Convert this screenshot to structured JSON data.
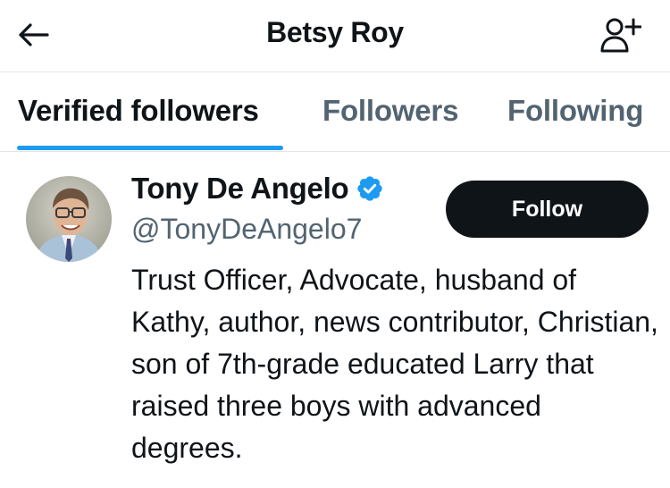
{
  "header": {
    "title": "Betsy Roy",
    "back_icon": "arrow-left-icon",
    "add_icon": "person-add-icon"
  },
  "tabs": [
    {
      "label": "Verified followers",
      "active": true
    },
    {
      "label": "Followers",
      "active": false
    },
    {
      "label": "Following",
      "active": false
    }
  ],
  "user": {
    "name": "Tony De Angelo",
    "handle": "@TonyDeAngelo7",
    "verified": true,
    "follow_label": "Follow",
    "bio": "Trust Officer, Advocate, husband of Kathy, author, news contributor, Christian, son of 7th-grade educated Larry that raised three boys with advanced degrees."
  },
  "colors": {
    "accent": "#1d9bf0",
    "text": "#0f1419",
    "secondary_text": "#536471",
    "button_bg": "#0f1419",
    "divider": "#e2e5e8"
  }
}
